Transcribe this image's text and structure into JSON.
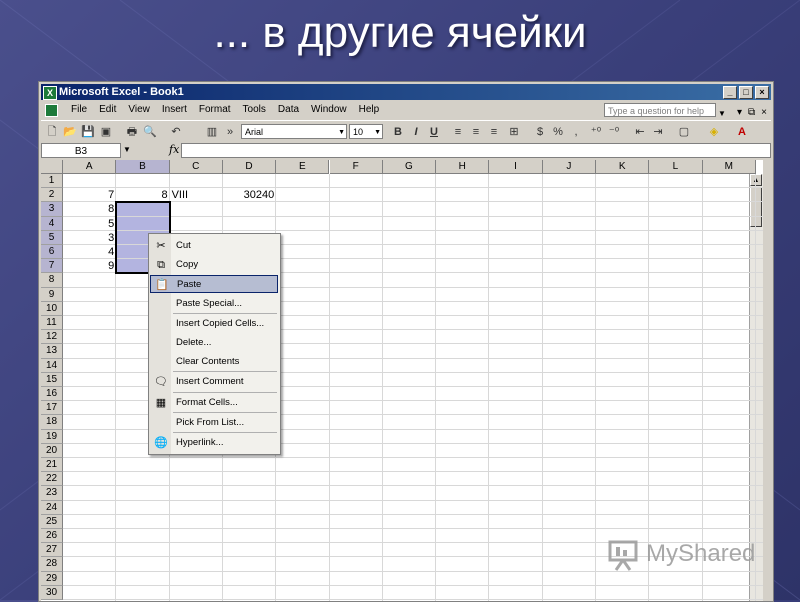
{
  "slide": {
    "title": "... в другие ячейки"
  },
  "window": {
    "title": "Microsoft Excel - Book1",
    "app_icon_glyph": "X"
  },
  "menubar": {
    "items": [
      "File",
      "Edit",
      "View",
      "Insert",
      "Format",
      "Tools",
      "Data",
      "Window",
      "Help"
    ],
    "help_placeholder": "Type a question for help"
  },
  "toolbar": {
    "font_name": "Arial",
    "font_size": "10",
    "bold": "B",
    "italic": "I",
    "underline": "U",
    "percent": "%",
    "comma": ","
  },
  "formula_bar": {
    "name_box": "B3",
    "fx": "fx",
    "value": ""
  },
  "columns": [
    "A",
    "B",
    "C",
    "D",
    "E",
    "F",
    "G",
    "H",
    "I",
    "J",
    "K",
    "L",
    "M"
  ],
  "rows": [
    "1",
    "2",
    "3",
    "4",
    "5",
    "6",
    "7",
    "8",
    "9",
    "10",
    "11",
    "12",
    "13",
    "14",
    "15",
    "16",
    "17",
    "18",
    "19",
    "20",
    "21",
    "22",
    "23",
    "24",
    "25",
    "26",
    "27",
    "28",
    "29",
    "30"
  ],
  "cells": {
    "A2": "7",
    "B2": "8",
    "C2": "VIII",
    "D2": "30240",
    "A3": "8",
    "A4": "5",
    "A5": "3",
    "A6": "4",
    "A7": "9"
  },
  "context_menu": {
    "items": [
      {
        "label": "Cut",
        "icon": "scissors-icon"
      },
      {
        "label": "Copy",
        "icon": "copy-icon"
      },
      {
        "label": "Paste",
        "icon": "paste-icon",
        "highlighted": true
      },
      {
        "label": "Paste Special...",
        "icon": ""
      },
      {
        "label": "Insert Copied Cells...",
        "icon": ""
      },
      {
        "label": "Delete...",
        "icon": ""
      },
      {
        "label": "Clear Contents",
        "icon": ""
      },
      {
        "label": "Insert Comment",
        "icon": "comment-icon"
      },
      {
        "label": "Format Cells...",
        "icon": "format-cells-icon"
      },
      {
        "label": "Pick From List...",
        "icon": ""
      },
      {
        "label": "Hyperlink...",
        "icon": "hyperlink-icon"
      }
    ]
  },
  "watermark": {
    "text": "MyShared"
  },
  "colors": {
    "slide_bg": "#3a3f7a",
    "title_bar": "#0a246a",
    "selection": "#b3b4e0",
    "menu_highlight": "#b6bdd2"
  }
}
